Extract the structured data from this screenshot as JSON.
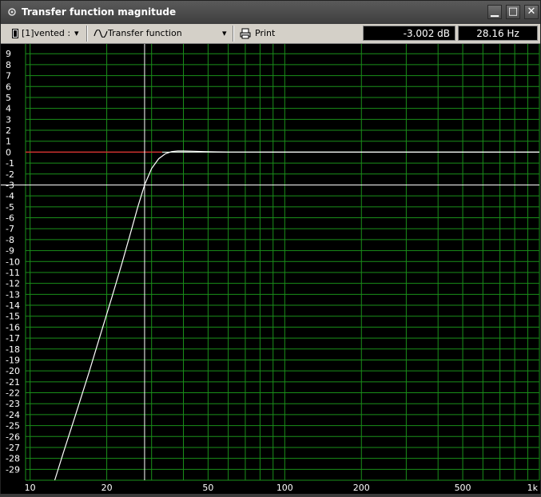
{
  "window": {
    "title": "Transfer function magnitude",
    "minimize_glyph": "▁",
    "maximize_glyph": "□",
    "close_glyph": "✕"
  },
  "toolbar": {
    "driver_select": "[1]vented :",
    "view_select": "Transfer function magnitude",
    "print_label": "Print",
    "dropdown_glyph": "▾"
  },
  "readouts": {
    "level": "-3.002 dB",
    "frequency": "28.16 Hz"
  },
  "icons": {
    "app": "speaker-icon",
    "driver": "speaker-icon",
    "view": "waveform-icon",
    "print": "printer-icon"
  },
  "chart_data": {
    "type": "line",
    "x_scale": "log",
    "xlim": [
      9.6,
      1000
    ],
    "ylim": [
      -30,
      9.6
    ],
    "x_ticks": [
      {
        "value": 10,
        "label": "10"
      },
      {
        "value": 20,
        "label": "20"
      },
      {
        "value": 50,
        "label": "50"
      },
      {
        "value": 100,
        "label": "100"
      },
      {
        "value": 200,
        "label": "200"
      },
      {
        "value": 500,
        "label": "500"
      },
      {
        "value": 1000,
        "label": "1k"
      }
    ],
    "y_ticks": [
      9,
      8,
      7,
      6,
      5,
      4,
      3,
      2,
      1,
      0,
      -1,
      -2,
      -3,
      -4,
      -5,
      -6,
      -7,
      -8,
      -9,
      -10,
      -11,
      -12,
      -13,
      -14,
      -15,
      -16,
      -17,
      -18,
      -19,
      -20,
      -21,
      -22,
      -23,
      -24,
      -25,
      -26,
      -27,
      -28,
      -29
    ],
    "grid": true,
    "cursor": {
      "x": 28.16,
      "y": -3.002
    },
    "reference_line": {
      "y": 0,
      "x_range": [
        9.6,
        33
      ]
    },
    "series": [
      {
        "x": [
          12.5,
          13.5,
          15,
          17,
          19,
          21,
          23,
          25,
          26.5,
          28.16,
          30,
          32,
          34,
          36,
          38,
          40,
          44,
          48,
          52,
          60,
          80,
          100,
          200,
          500,
          1000
        ],
        "y": [
          -30,
          -27.5,
          -24.2,
          -20.2,
          -16.5,
          -13.2,
          -10.1,
          -7.1,
          -5.0,
          -3.0,
          -1.5,
          -0.6,
          -0.15,
          0.05,
          0.1,
          0.1,
          0.08,
          0.05,
          0.03,
          0.01,
          0,
          0,
          0,
          0,
          0
        ]
      }
    ],
    "colors": {
      "background": "#000000",
      "grid": "#1a8f1a",
      "curve": "#ffffff",
      "reference": "#d03030",
      "cursor": "#ffffff",
      "labels": "#ffffff"
    }
  }
}
